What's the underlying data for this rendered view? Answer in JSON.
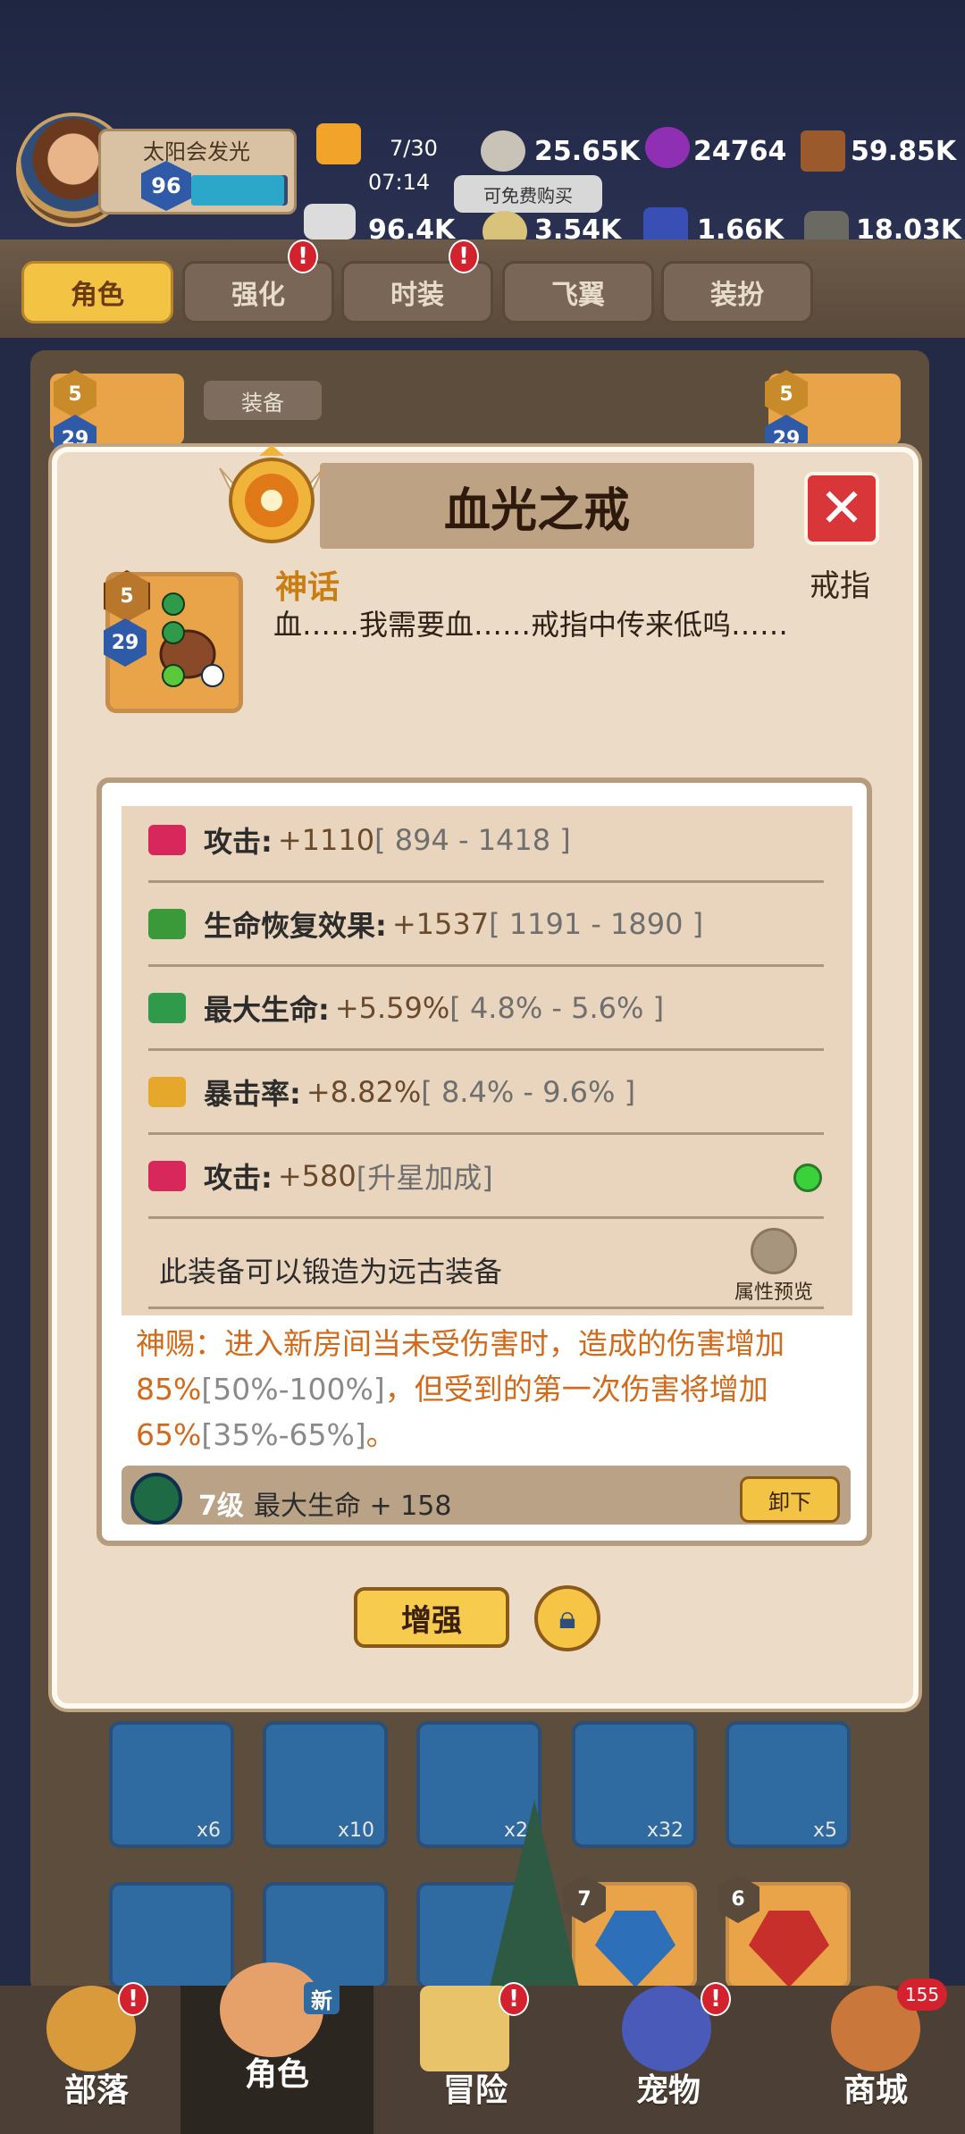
{
  "header": {
    "player_name": "太阳会发光",
    "player_level": "96",
    "energy": "7/30",
    "energy_timer": "07:14",
    "free_buy_tooltip": "可免费购买",
    "resources_top": [
      "25.65K",
      "24764",
      "59.85K"
    ],
    "resources_bottom": [
      "96.4K",
      "3.54K",
      "1.66K",
      "18.03K"
    ]
  },
  "tabs": [
    "角色",
    "强化",
    "时装",
    "飞翼",
    "装扮"
  ],
  "background": {
    "equip_label": "装备",
    "slot_left_star": "5",
    "slot_left_level": "29",
    "slot_right_star": "5",
    "slot_right_level": "29",
    "scroll_counts": [
      "x6",
      "x10",
      "x2",
      "x32",
      "x5"
    ],
    "gem_levels": [
      "7",
      "6"
    ]
  },
  "modal": {
    "title": "血光之戒",
    "item_star": "5",
    "item_level": "29",
    "rarity": "神话",
    "slot_type": "戒指",
    "flavor": "血……我需要血……戒指中传来低呜……",
    "stats": [
      {
        "name": "攻击:",
        "value": "+1110",
        "range": "[ 894 - 1418 ]"
      },
      {
        "name": "生命恢复效果:",
        "value": "+1537",
        "range": "[ 1191 - 1890 ]"
      },
      {
        "name": "最大生命:",
        "value": "+5.59%",
        "range": "[ 4.8% - 5.6% ]"
      },
      {
        "name": "暴击率:",
        "value": "+8.82%",
        "range": "[ 8.4% - 9.6% ]"
      },
      {
        "name": "攻击:",
        "value": "+580",
        "range": "[升星加成]"
      }
    ],
    "forge_text": "此装备可以锻造为远古装备",
    "preview_label": "属性预览",
    "divine_line1": "神赐：进入新房间当未受伤害时，造成的伤害增加",
    "divine_line2a": "85%",
    "divine_line2b": "[50%-100%]",
    "divine_line2c": "，但受到的第一次伤害将增加",
    "divine_line3a": "65%",
    "divine_line3b": "[35%-65%]",
    "divine_line3c": "。",
    "gem_level": "7级",
    "gem_stat": "最大生命 + 158",
    "unequip_label": "卸下",
    "enhance_label": "增强"
  },
  "nav": {
    "items": [
      "部落",
      "角色",
      "冒险",
      "宠物",
      "商城"
    ],
    "new_badge": "新",
    "shop_count": "155",
    "alert_mark": "!"
  },
  "colors": {
    "accent": "#f3c443",
    "divine_text": "#d16a1a",
    "close": "#d9363a",
    "alert": "#d3222e"
  }
}
